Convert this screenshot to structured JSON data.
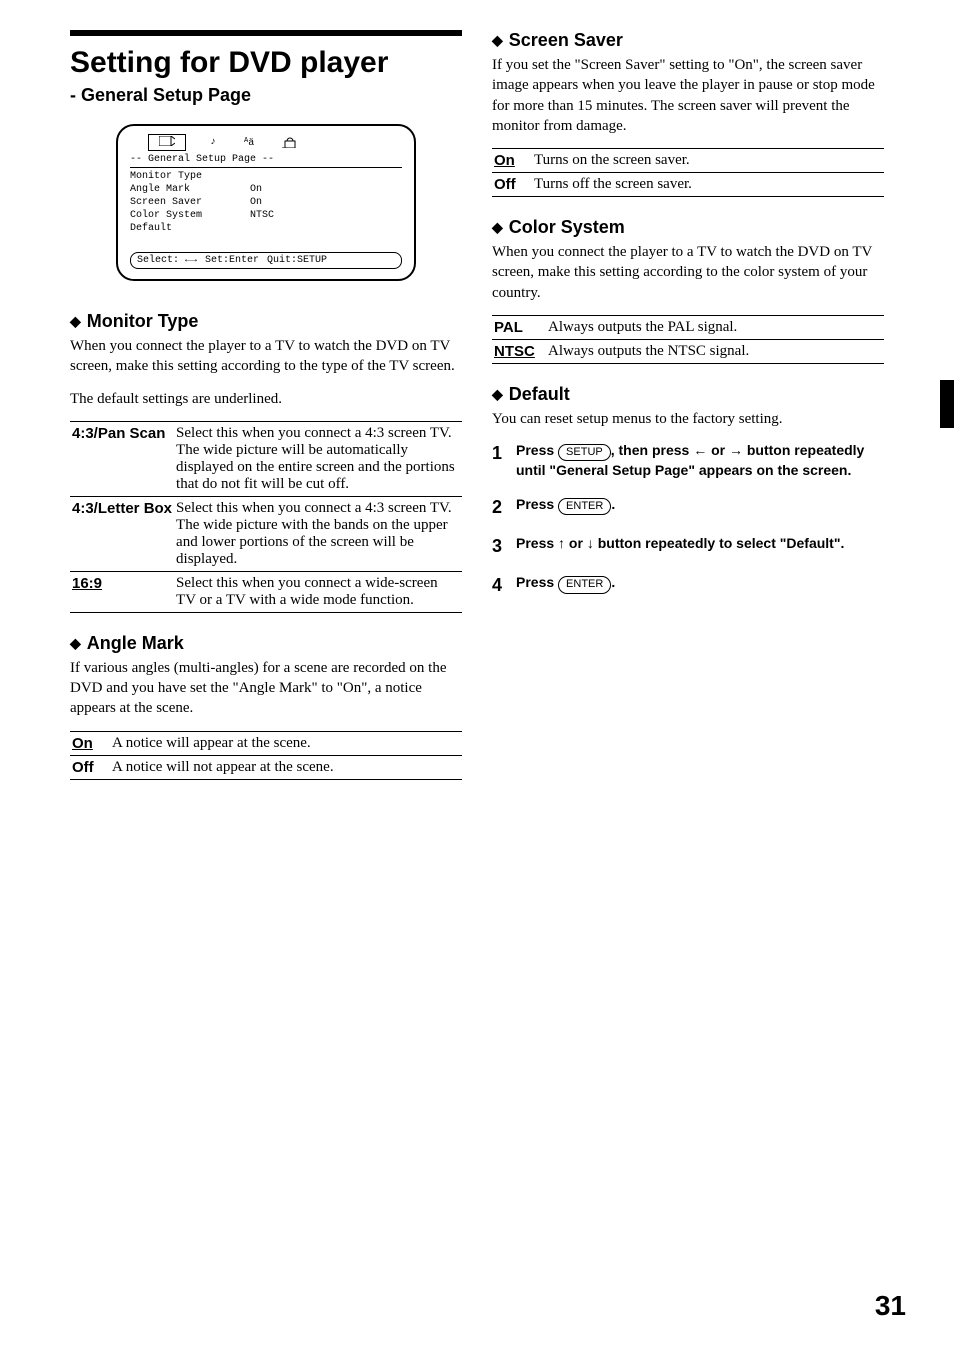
{
  "page_number": "31",
  "left": {
    "main_title": "Setting for DVD player",
    "subtitle": "- General Setup Page",
    "osd": {
      "title": "-- General Setup Page --",
      "rows": [
        {
          "label": "Monitor Type",
          "value": ""
        },
        {
          "label": "Angle Mark",
          "value": "On"
        },
        {
          "label": "Screen Saver",
          "value": "On"
        },
        {
          "label": "Color System",
          "value": "NTSC"
        },
        {
          "label": "Default",
          "value": ""
        }
      ],
      "footer_select": "Select:",
      "footer_set": "Set:Enter",
      "footer_quit": "Quit:SETUP"
    },
    "monitor": {
      "head": "Monitor Type",
      "p1": "When you connect the player to a TV to watch the DVD on TV screen, make this setting according to the type of the TV screen.",
      "p2": "The default settings are underlined.",
      "rows": [
        {
          "label": "4:3/Pan Scan",
          "desc": "Select this when you connect a 4:3 screen TV. The wide picture will be automatically displayed on the entire screen and the portions that do not fit will be cut off."
        },
        {
          "label": "4:3/Letter Box",
          "desc": "Select this when you connect a 4:3 screen TV. The wide picture with the bands on the upper and lower portions of the screen will be displayed."
        },
        {
          "label": "16:9",
          "underline": true,
          "desc": "Select this when you connect a wide-screen TV or a TV with a wide mode function."
        }
      ]
    },
    "angle": {
      "head": "Angle Mark",
      "p": "If various angles (multi-angles) for a scene are recorded on the DVD and you have set the \"Angle Mark\" to \"On\", a notice appears at the scene.",
      "rows": [
        {
          "label": "On",
          "underline": true,
          "desc": "A notice will appear at the scene."
        },
        {
          "label": "Off",
          "desc": "A notice will not appear at the scene."
        }
      ]
    }
  },
  "right": {
    "screensaver": {
      "head": "Screen Saver",
      "p": "If you set the \"Screen Saver\" setting to \"On\", the screen saver image appears when you leave the player in pause or stop mode for more than 15 minutes. The screen saver will prevent the monitor from damage.",
      "rows": [
        {
          "label": "On",
          "underline": true,
          "desc": "Turns on the screen saver."
        },
        {
          "label": "Off",
          "desc": "Turns off the screen saver."
        }
      ]
    },
    "colorsystem": {
      "head": "Color System",
      "p": "When you connect the player to a TV to watch the DVD on TV screen, make this setting according to the color system of your country.",
      "rows": [
        {
          "label": "PAL",
          "desc": "Always outputs the PAL signal."
        },
        {
          "label": "NTSC",
          "underline": true,
          "desc": "Always outputs the NTSC signal."
        }
      ]
    },
    "default": {
      "head": "Default",
      "p": "You can reset setup menus to the factory setting.",
      "steps": {
        "s1a": "Press ",
        "s1_key": "SETUP",
        "s1b": ", then press ",
        "s1c": " or ",
        "s1d": " button repeatedly until \"General Setup Page\" appears on the screen.",
        "s2a": "Press ",
        "s2_key": "ENTER",
        "s2b": ".",
        "s3a": "Press ",
        "s3b": " or ",
        "s3c": " button repeatedly to select \"Default\".",
        "s4a": "Press ",
        "s4_key": "ENTER",
        "s4b": "."
      }
    }
  }
}
